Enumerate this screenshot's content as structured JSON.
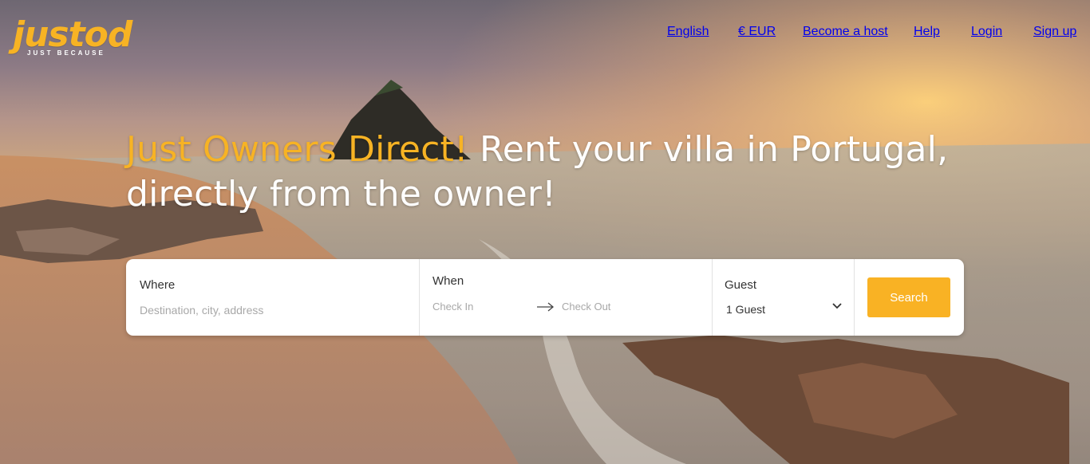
{
  "brand": {
    "name": "justod",
    "tagline": "JUST BECAUSE",
    "color": "#f7b324"
  },
  "nav": {
    "language": "English",
    "currency": "€ EUR",
    "become_host": "Become a host",
    "help": "Help",
    "login": "Login",
    "signup": "Sign up"
  },
  "hero": {
    "headline_accent": "Just Owners Direct!",
    "headline_rest": " Rent your villa in Portugal, directly from the owner!"
  },
  "search": {
    "where_label": "Where",
    "where_placeholder": "Destination, city, address",
    "when_label": "When",
    "check_in": "Check In",
    "check_out": "Check Out",
    "guest_label": "Guest",
    "guest_value": "1 Guest",
    "button": "Search",
    "button_color": "#f9b224"
  }
}
